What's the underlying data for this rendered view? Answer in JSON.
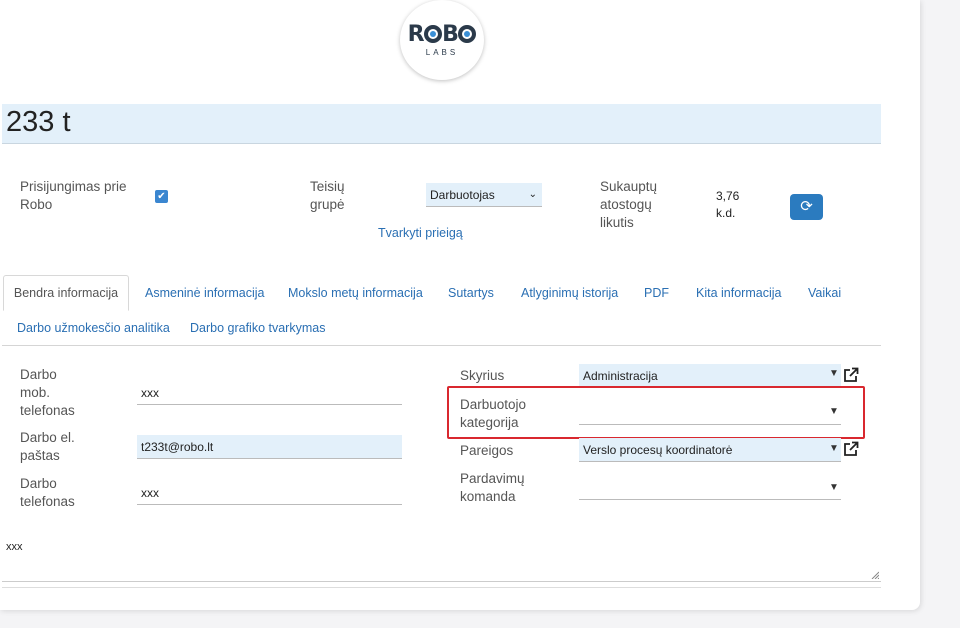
{
  "logo": {
    "main": "ROBO",
    "sub": "LABS"
  },
  "employee": {
    "name": "233 t"
  },
  "summary": {
    "login_label": "Prisijungimas prie Robo",
    "rights_group_label": "Teisių grupė",
    "rights_group_value": "Darbuotojas",
    "manage_access_link": "Tvarkyti prieigą",
    "vacation_label": "Sukauptų atostogų likutis",
    "vacation_value": "3,76 k.d."
  },
  "tabs": [
    "Bendra informacija",
    "Asmeninė informacija",
    "Mokslo metų informacija",
    "Sutartys",
    "Atlyginimų istorija",
    "PDF",
    "Kita informacija",
    "Vaikai",
    "Darbo užmokesčio analitika",
    "Darbo grafiko tvarkymas"
  ],
  "contact": {
    "mobile_label": "Darbo mob. telefonas",
    "mobile_value": "xxx",
    "email_label": "Darbo el. paštas",
    "email_value": "t233t@robo.lt",
    "phone_label": "Darbo telefonas",
    "phone_value": "xxx"
  },
  "org": {
    "department_label": "Skyrius",
    "department_value": "Administracija",
    "category_label": "Darbuotojo kategorija",
    "category_value": "",
    "position_label": "Pareigos",
    "position_value": "Verslo procesų koordinatorė",
    "sales_team_label": "Pardavimų komanda",
    "sales_team_value": ""
  },
  "notes": {
    "value": "xxx"
  },
  "colors": {
    "accent": "#2b7bbf",
    "highlight": "#d9282f",
    "field_fill": "#e3f0fa"
  }
}
